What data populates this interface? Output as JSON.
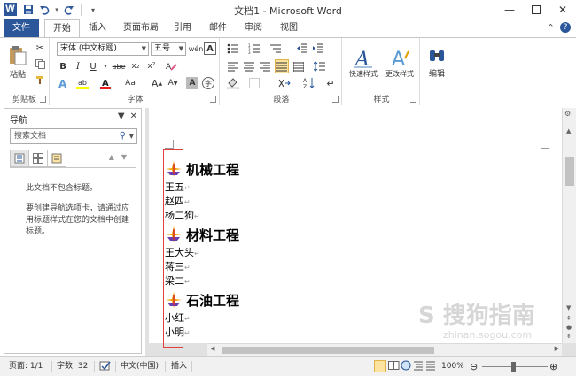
{
  "window": {
    "title": "文档1 - Microsoft Word",
    "app_icon": "W",
    "controls": [
      "minimize",
      "maximize",
      "close"
    ]
  },
  "quick_access": [
    "save-icon",
    "undo-icon",
    "redo-icon",
    "customize-icon"
  ],
  "tabs": [
    {
      "label": "文件",
      "type": "file"
    },
    {
      "label": "开始",
      "active": true
    },
    {
      "label": "插入"
    },
    {
      "label": "页面布局"
    },
    {
      "label": "引用"
    },
    {
      "label": "邮件"
    },
    {
      "label": "审阅"
    },
    {
      "label": "视图"
    }
  ],
  "ribbon": {
    "clipboard": {
      "label": "剪贴板",
      "paste": "粘贴"
    },
    "font": {
      "label": "字体",
      "font_name": "宋体 (中文标题)",
      "font_size": "五号",
      "wen_btn": "wén",
      "a_box": "A",
      "bold": "B",
      "italic": "I",
      "underline": "U",
      "strike": "abe",
      "sub": "x₂",
      "sup": "x²",
      "color_a": "A",
      "aa": "Aa",
      "grow": "A",
      "shrink": "A"
    },
    "paragraph": {
      "label": "段落"
    },
    "styles": {
      "label": "样式",
      "quick": "快速样式",
      "change": "更改样式"
    },
    "editing": {
      "label": "编辑"
    }
  },
  "nav_pane": {
    "title": "导航",
    "search_placeholder": "搜索文档",
    "msg1": "此文档不包含标题。",
    "msg2": "要创建导航选项卡，请通过应用标题样式在您的文档中创建标题。"
  },
  "document": {
    "para_mark": "↵",
    "sections": [
      {
        "heading": "机械工程",
        "items": [
          "王五",
          "赵四",
          "杨二狗"
        ]
      },
      {
        "heading": "材料工程",
        "items": [
          "王大头",
          "蒋三",
          "梁二"
        ]
      },
      {
        "heading": "石油工程",
        "items": [
          "小红",
          "小明"
        ]
      }
    ]
  },
  "status_bar": {
    "page": "页面: 1/1",
    "words": "字数: 32",
    "language": "中文(中国)",
    "mode": "插入",
    "zoom": "100%",
    "zoom_level": 1.0
  },
  "watermark": {
    "text": "S 搜狗指南",
    "sub": "zhinan.sogou.com"
  },
  "colors": {
    "file_tab": "#2b579a",
    "selection_border": "#e0403c",
    "highlight_yellow": "#ffff00",
    "font_red": "#e81e1e"
  }
}
